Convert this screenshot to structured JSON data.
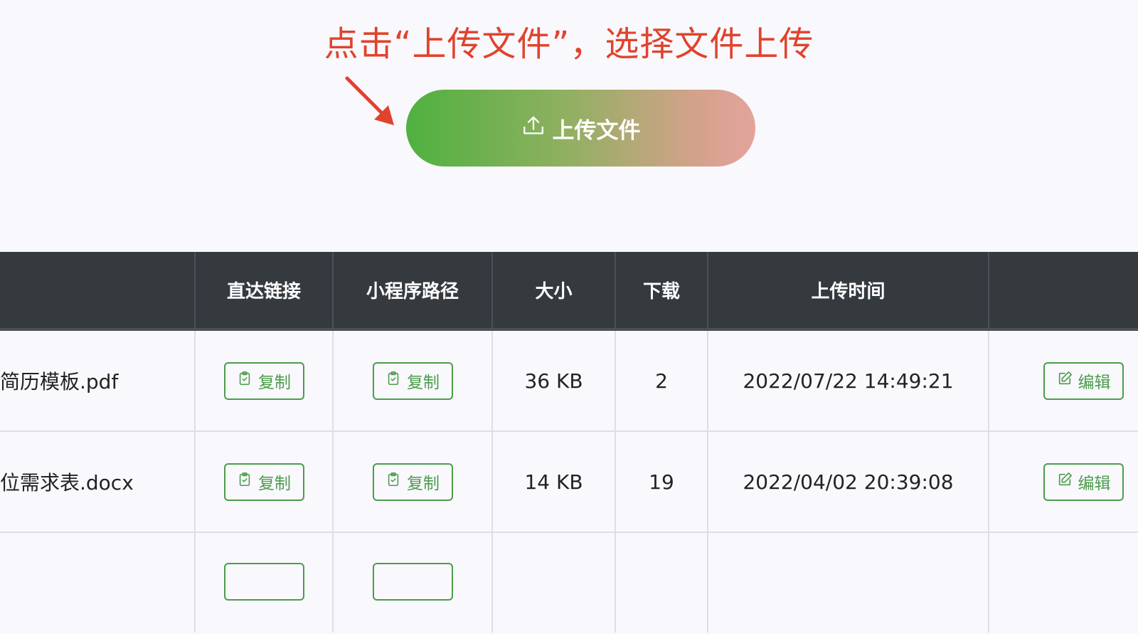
{
  "hint": "点击“上传文件”，选择文件上传",
  "upload_button": {
    "label": "上传文件",
    "icon": "upload-icon"
  },
  "colors": {
    "accent_green": "#4b9d4a",
    "hint_red": "#e0432c",
    "header_dark": "#353a3e"
  },
  "table": {
    "headers": {
      "name": "",
      "link": "直达链接",
      "path": "小程序路径",
      "size": "大小",
      "downloads": "下载",
      "upload_time": "上传时间",
      "actions": ""
    },
    "rows": [
      {
        "name": "简历模板.pdf",
        "link_button": "复制",
        "path_button": "复制",
        "size": "36 KB",
        "downloads": "2",
        "upload_time": "2022/07/22 14:49:21",
        "edit_button": "编辑"
      },
      {
        "name": "位需求表.docx",
        "link_button": "复制",
        "path_button": "复制",
        "size": "14 KB",
        "downloads": "19",
        "upload_time": "2022/04/02 20:39:08",
        "edit_button": "编辑"
      },
      {
        "name": "",
        "link_button": "",
        "path_button": "",
        "size": "",
        "downloads": "",
        "upload_time": "",
        "edit_button": ""
      }
    ]
  }
}
